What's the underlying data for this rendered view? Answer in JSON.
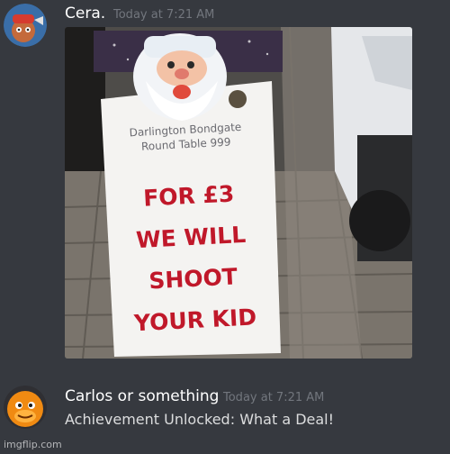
{
  "messages": [
    {
      "username": "Cera.",
      "timestamp": "Today at 7:21 AM",
      "avatar_icon": "user-avatar-icon",
      "attachment": {
        "sign": {
          "line1": "Darlington Bondgate",
          "line2": "Round Table 999",
          "headline": [
            "FOR £3",
            "WE WILL",
            "SHOOT",
            "YOUR KID"
          ]
        }
      }
    },
    {
      "username": "Carlos or something",
      "timestamp": "Today at 7:21 AM",
      "avatar_icon": "orange-character-avatar-icon",
      "text": "Achievement Unlocked: What a Deal!"
    }
  ],
  "watermark": "imgflip.com",
  "colors": {
    "background": "#36393f",
    "username": "#ffffff",
    "timestamp": "#72767d",
    "message_text": "#dcddde",
    "sign_red": "#c0182a"
  }
}
